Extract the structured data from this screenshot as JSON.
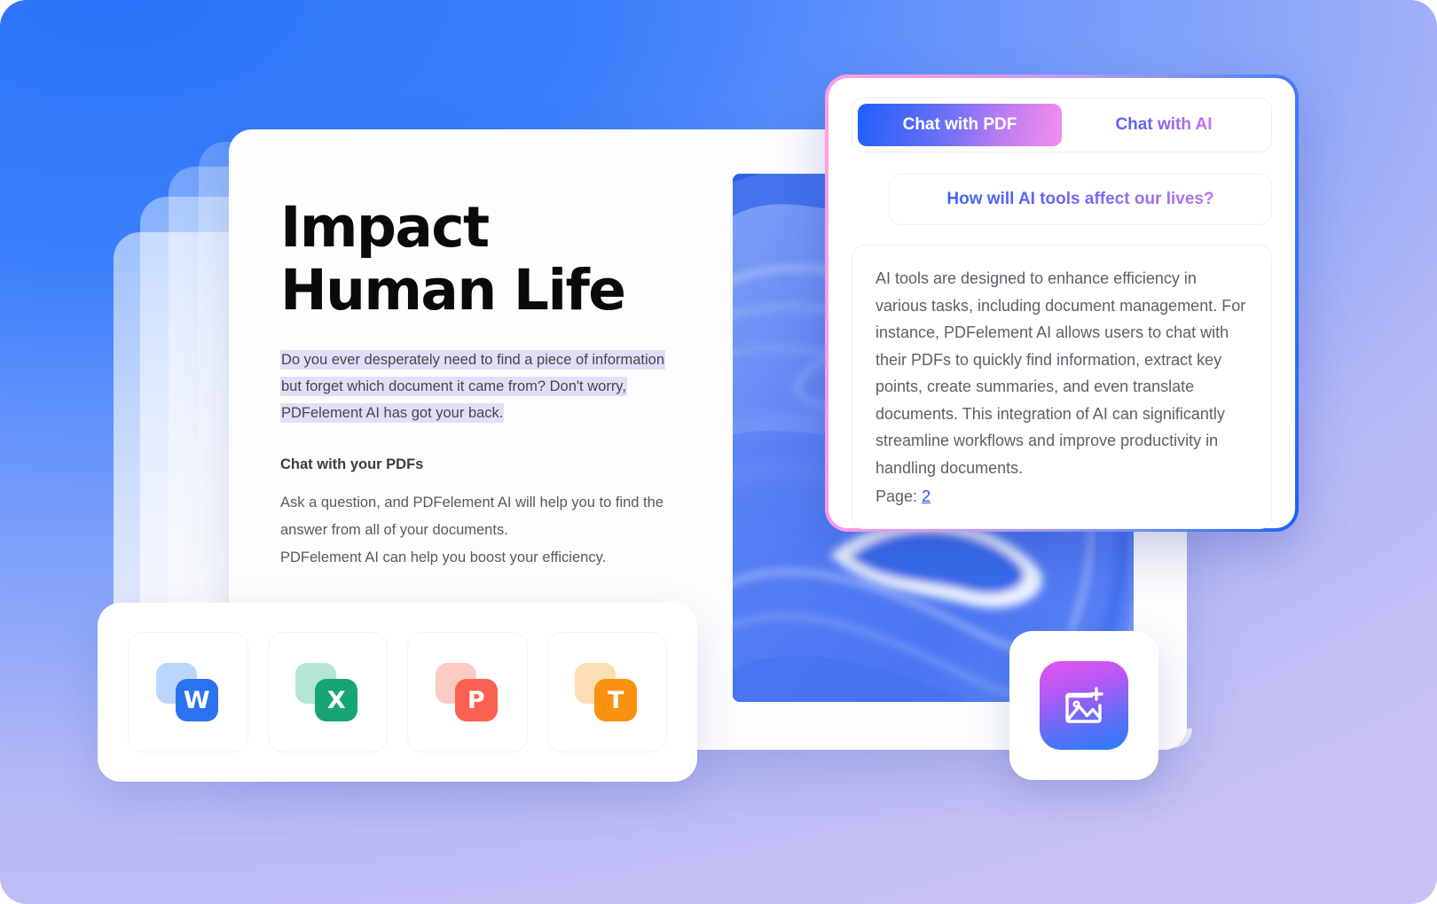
{
  "background": {
    "gradient_from": "#2470fa",
    "gradient_to": "#c8c2f5"
  },
  "document": {
    "title": "Impact\nHuman Life",
    "highlighted_paragraph": "Do you ever desperately need to find a piece of information but forget which document it came from? Don't worry, PDFelement AI has got your back.",
    "highlight_color": "#e3def8",
    "subheading": "Chat with your PDFs",
    "body": "Ask a question, and PDFelement AI will help you to find the answer from all of your documents.\nPDFelement AI can help you boost your efficiency."
  },
  "chat_panel": {
    "tabs": [
      {
        "label": "Chat with PDF",
        "active": true
      },
      {
        "label": "Chat with AI",
        "active": false
      }
    ],
    "question": "How will AI tools affect our lives?",
    "answer": "AI tools are designed to enhance efficiency in various tasks, including document management. For instance, PDFelement AI allows users to chat with their PDFs to quickly find information, extract key points, create summaries, and even translate documents. This integration of AI can significantly streamline workflows and improve productivity in  handling documents.",
    "page_label": "Page:",
    "page_number": "2",
    "border_gradient_from": "#ff9fe0",
    "border_gradient_to": "#1b63f5"
  },
  "formats": [
    {
      "name": "word",
      "letter": "W",
      "front_color": "#2b72f0",
      "back_color": "#bcd6fb",
      "icon": "word-file-icon"
    },
    {
      "name": "excel",
      "letter": "X",
      "front_color": "#17a673",
      "back_color": "#b5e6d3",
      "icon": "excel-file-icon"
    },
    {
      "name": "powerpoint",
      "letter": "P",
      "front_color": "#fb6150",
      "back_color": "#fbcbc4",
      "icon": "powerpoint-file-icon"
    },
    {
      "name": "text",
      "letter": "T",
      "front_color": "#fb9110",
      "back_color": "#fbdfb2",
      "icon": "text-file-icon"
    }
  ],
  "image_add": {
    "icon": "add-image-icon",
    "gradient_from": "#e355f0",
    "gradient_to": "#2a7cf8"
  }
}
